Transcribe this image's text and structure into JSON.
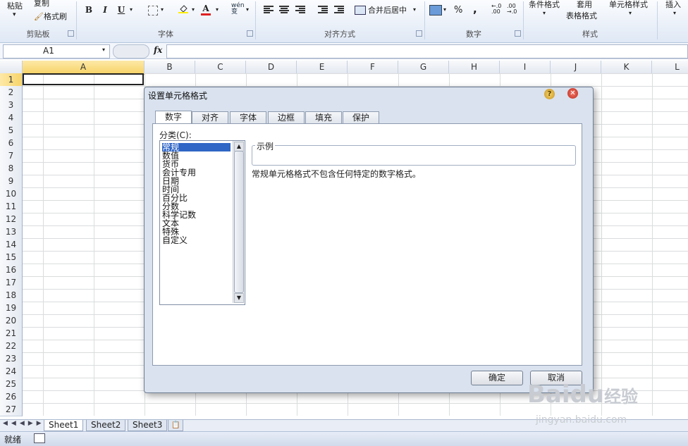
{
  "ribbon": {
    "paste_label": "粘贴",
    "copy_label": "复制",
    "format_painter_label": "格式刷",
    "bold": "B",
    "italic": "I",
    "underline": "U",
    "font_color_letter": "A",
    "wen_label": "wén\n变",
    "merge_center_label": "合并后居中",
    "percent": "%",
    "comma": ",",
    "conditional_format_label": "条件格式",
    "table_format_label_1": "套用",
    "table_format_label_2": "表格格式",
    "cell_style_label": "单元格样式",
    "insert_label": "插入",
    "groups": {
      "clipboard": "剪贴板",
      "font": "字体",
      "alignment": "对齐方式",
      "number": "数字",
      "styles": "样式"
    }
  },
  "formula_bar": {
    "name_box": "A1",
    "fx": "fx",
    "formula": ""
  },
  "grid": {
    "columns": [
      "A",
      "B",
      "C",
      "D",
      "E",
      "F",
      "G",
      "H",
      "I",
      "J",
      "K",
      "L"
    ],
    "rows": [
      "1",
      "2",
      "3",
      "4",
      "5",
      "6",
      "7",
      "8",
      "9",
      "10",
      "11",
      "12",
      "13",
      "14",
      "15",
      "16",
      "17",
      "18",
      "19",
      "20",
      "21",
      "22",
      "23",
      "24",
      "25",
      "26",
      "27"
    ],
    "selected_cell": "A1"
  },
  "sheet_tabs": [
    "Sheet1",
    "Sheet2",
    "Sheet3"
  ],
  "status": {
    "ready": "就绪"
  },
  "dialog": {
    "title": "设置单元格格式",
    "tabs": [
      "数字",
      "对齐",
      "字体",
      "边框",
      "填充",
      "保护"
    ],
    "active_tab": "数字",
    "category_label": "分类(C):",
    "categories": [
      "常规",
      "数值",
      "货币",
      "会计专用",
      "日期",
      "时间",
      "百分比",
      "分数",
      "科学记数",
      "文本",
      "特殊",
      "自定义"
    ],
    "selected_category": "常规",
    "sample_label": "示例",
    "description": "常规单元格格式不包含任何特定的数字格式。",
    "ok": "确定",
    "cancel": "取消"
  },
  "watermark": {
    "brand": "Baidu",
    "suffix": "经验",
    "url": "jingyan.baidu.com"
  }
}
